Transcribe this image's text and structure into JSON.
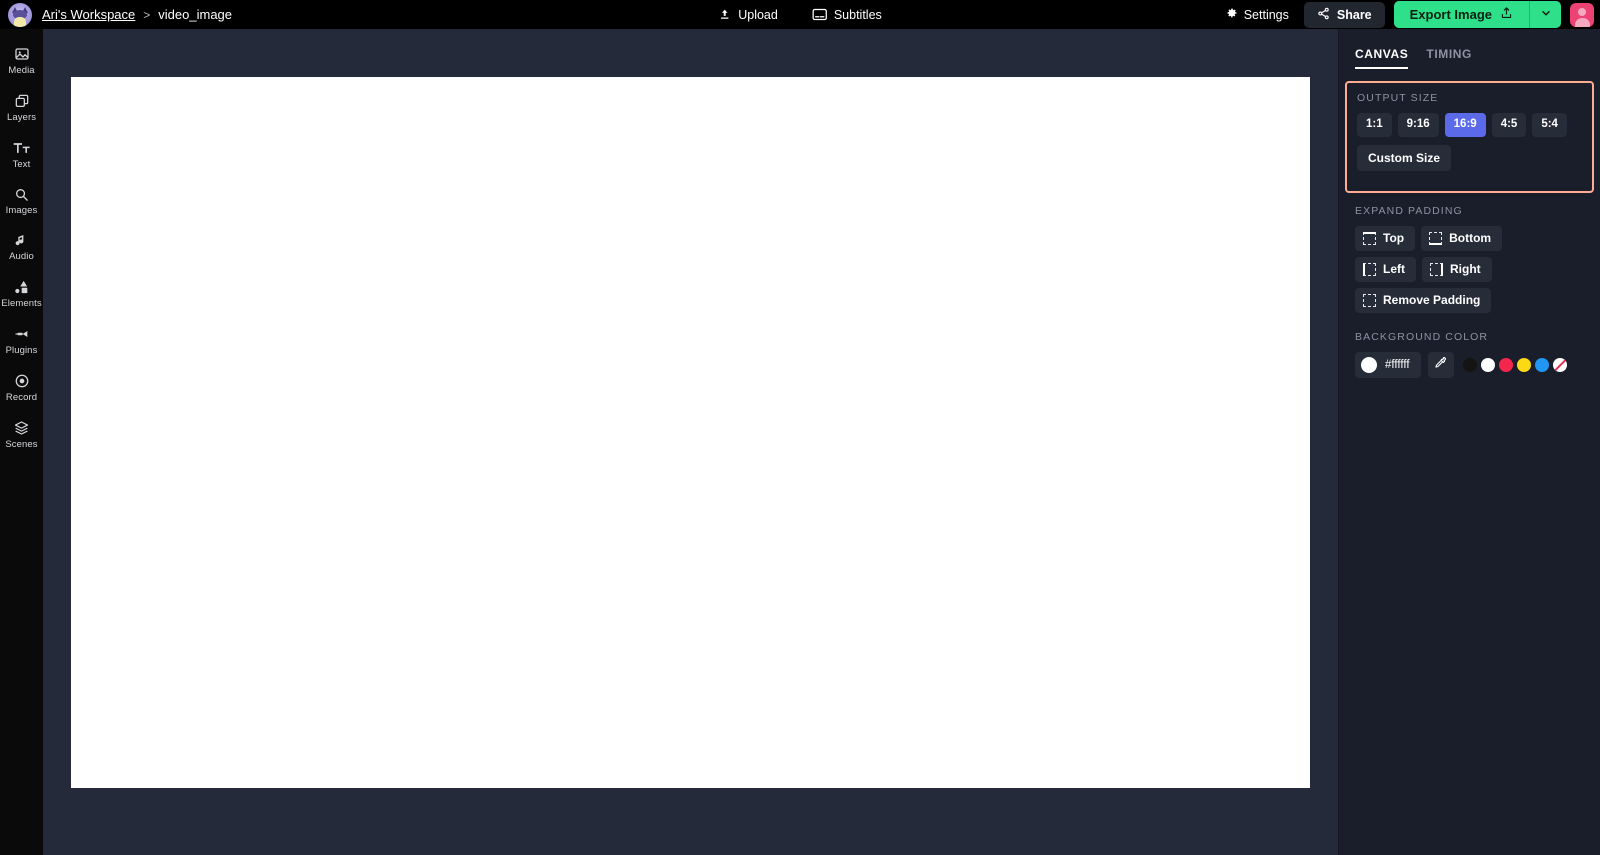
{
  "topbar": {
    "logo_icon": "workspace-avatar-icon",
    "workspace_name": "Ari's Workspace",
    "separator": ">",
    "project_name": "video_image",
    "center_actions": [
      {
        "label": "Upload",
        "icon": "upload-icon"
      },
      {
        "label": "Subtitles",
        "icon": "subtitles-icon"
      }
    ],
    "settings_label": "Settings",
    "settings_icon": "gear-icon",
    "share_label": "Share",
    "share_icon": "share-icon",
    "export_label": "Export Image",
    "export_icon": "export-upload-icon",
    "export_caret_icon": "chevron-down-icon",
    "avatar_icon": "user-avatar-icon",
    "export_color": "#2ee08a",
    "avatar_color": "#ec4374"
  },
  "sidebar": {
    "items": [
      {
        "label": "Media",
        "icon": "image-icon"
      },
      {
        "label": "Layers",
        "icon": "layers-stack-icon"
      },
      {
        "label": "Text",
        "icon": "text-tt-icon"
      },
      {
        "label": "Images",
        "icon": "search-icon"
      },
      {
        "label": "Audio",
        "icon": "music-note-icon"
      },
      {
        "label": "Elements",
        "icon": "shapes-icon"
      },
      {
        "label": "Plugins",
        "icon": "plug-icon"
      },
      {
        "label": "Record",
        "icon": "record-circle-icon"
      },
      {
        "label": "Scenes",
        "icon": "scenes-layers-icon"
      }
    ]
  },
  "stage": {
    "background_color": "#252a3a",
    "canvas_color": "#ffffff"
  },
  "panel": {
    "tabs": [
      {
        "label": "CANVAS",
        "active": true
      },
      {
        "label": "TIMING",
        "active": false
      }
    ],
    "highlight_color": "#ffab91",
    "output_size": {
      "title": "OUTPUT SIZE",
      "ratios": [
        {
          "label": "1:1",
          "selected": false
        },
        {
          "label": "9:16",
          "selected": false
        },
        {
          "label": "16:9",
          "selected": true
        },
        {
          "label": "4:5",
          "selected": false
        },
        {
          "label": "5:4",
          "selected": false
        }
      ],
      "selected_color": "#5b6ae8",
      "custom_label": "Custom Size"
    },
    "expand_padding": {
      "title": "EXPAND PADDING",
      "buttons": [
        {
          "label": "Top",
          "icon": "padding-top-icon",
          "dir": "top"
        },
        {
          "label": "Bottom",
          "icon": "padding-bottom-icon",
          "dir": "bottom"
        },
        {
          "label": "Left",
          "icon": "padding-left-icon",
          "dir": "left"
        },
        {
          "label": "Right",
          "icon": "padding-right-icon",
          "dir": "right"
        }
      ],
      "remove_label": "Remove Padding",
      "remove_icon": "padding-remove-icon"
    },
    "background_color": {
      "title": "BACKGROUND COLOR",
      "hex": "#ffffff",
      "picker_icon": "eyedropper-icon",
      "swatches": [
        {
          "name": "black",
          "color": "#141414"
        },
        {
          "name": "white",
          "color": "#ffffff"
        },
        {
          "name": "red",
          "color": "#f5264d"
        },
        {
          "name": "yellow",
          "color": "#fbd915"
        },
        {
          "name": "blue",
          "color": "#2196f3"
        },
        {
          "name": "transparent",
          "color": "transparent"
        }
      ]
    }
  }
}
